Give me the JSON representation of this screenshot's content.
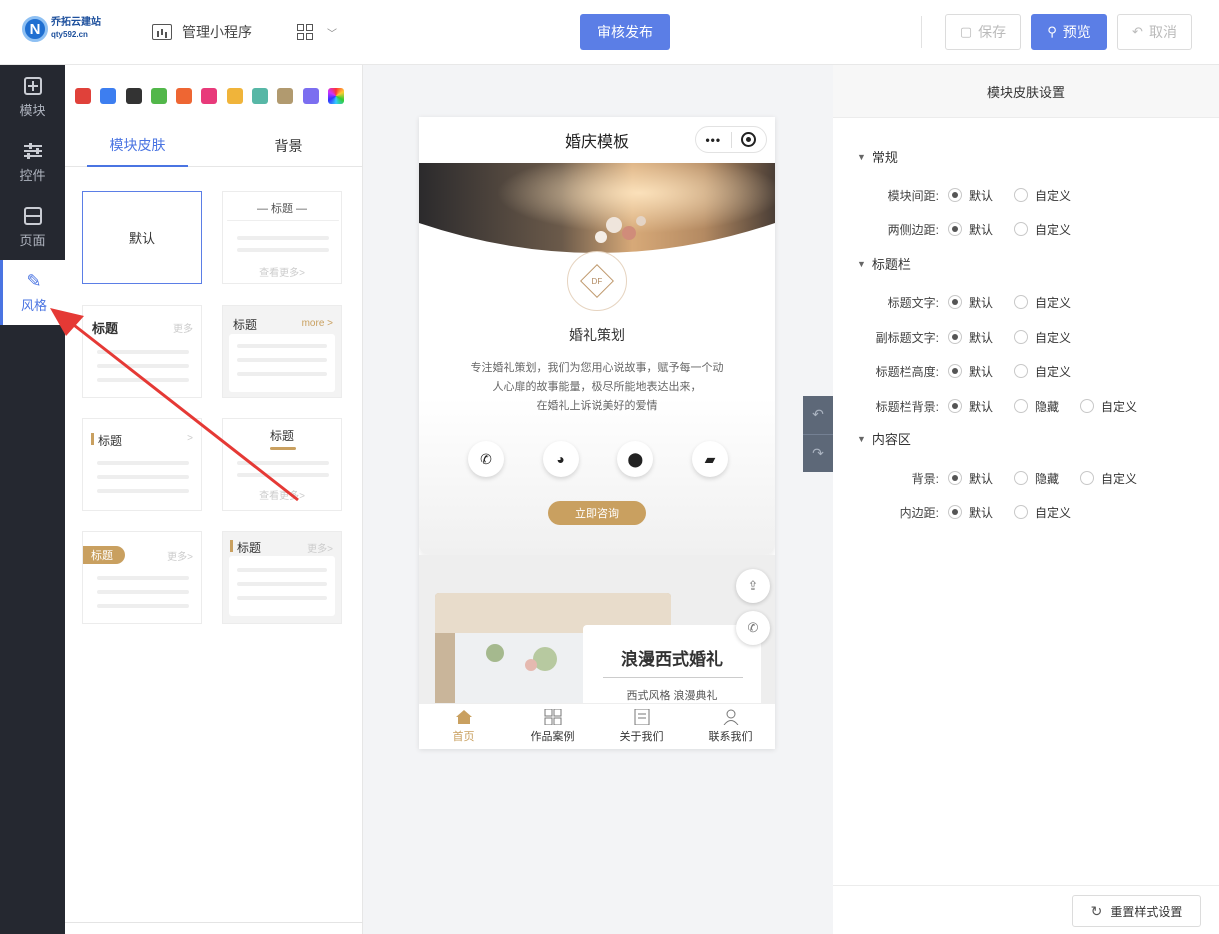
{
  "app": {
    "logo_name": "乔拓云建站",
    "logo_url": "qty592.cn",
    "manage_label": "管理小程序",
    "publish_label": "审核发布",
    "save_label": "保存",
    "preview_label": "预览",
    "cancel_label": "取消",
    "accent_color": "#5b7ee6"
  },
  "left_nav": {
    "items": [
      {
        "label": "模块",
        "icon": "plus-square-icon"
      },
      {
        "label": "控件",
        "icon": "sliders-icon"
      },
      {
        "label": "页面",
        "icon": "page-icon"
      },
      {
        "label": "风格",
        "icon": "magic-wand-icon",
        "active": true
      }
    ]
  },
  "style_panel": {
    "swatches": [
      "#e0413a",
      "#3d7ef0",
      "#333333",
      "#52b74a",
      "#ee6633",
      "#e83a7a",
      "#f0b43a",
      "#57b7a6",
      "#b19a6f",
      "#7b6ef0",
      "rainbow"
    ],
    "tabs": [
      "模块皮肤",
      "背景"
    ],
    "active_tab": 0,
    "cards": [
      {
        "kind": "default",
        "label": "默认",
        "selected": true
      },
      {
        "kind": "centered",
        "title": "标题",
        "more": "查看更多>"
      },
      {
        "kind": "bold-left",
        "title": "标题",
        "more": "更多"
      },
      {
        "kind": "card-more",
        "title": "标题",
        "more": "more >"
      },
      {
        "kind": "bar-left",
        "title": "标题",
        "more": ">"
      },
      {
        "kind": "underline",
        "title": "标题",
        "more": "查看更多>"
      },
      {
        "kind": "tag",
        "title": "标题",
        "more": "更多>"
      },
      {
        "kind": "grey-bar",
        "title": "标题",
        "more": "更多>"
      }
    ]
  },
  "phone": {
    "page_title": "婚庆模板",
    "emblem_text": "DF",
    "brand_title": "婚礼策划",
    "desc_lines": [
      "专注婚礼策划，我们为您用心说故事，赋予每一个动",
      "人心扉的故事能量，极尽所能地表达出来，",
      "在婚礼上诉说美好的爱情"
    ],
    "action_icons": [
      "phone-icon",
      "wechat-icon",
      "location-icon",
      "message-icon"
    ],
    "consult_label": "立即咨询",
    "feature_title": "浪漫西式婚礼",
    "feature_sub": "西式风格 浪漫典礼",
    "tabbar": [
      {
        "label": "首页",
        "active": true
      },
      {
        "label": "作品案例"
      },
      {
        "label": "关于我们"
      },
      {
        "label": "联系我们"
      }
    ],
    "gold_color": "#c9a060"
  },
  "right_panel": {
    "title": "模块皮肤设置",
    "sections": [
      {
        "name": "常规",
        "rows": [
          {
            "label": "模块间距:",
            "options": [
              "默认",
              "自定义"
            ],
            "selected": 0
          },
          {
            "label": "两侧边距:",
            "options": [
              "默认",
              "自定义"
            ],
            "selected": 0
          }
        ]
      },
      {
        "name": "标题栏",
        "rows": [
          {
            "label": "标题文字:",
            "options": [
              "默认",
              "自定义"
            ],
            "selected": 0
          },
          {
            "label": "副标题文字:",
            "options": [
              "默认",
              "自定义"
            ],
            "selected": 0
          },
          {
            "label": "标题栏高度:",
            "options": [
              "默认",
              "自定义"
            ],
            "selected": 0
          },
          {
            "label": "标题栏背景:",
            "options": [
              "默认",
              "隐藏",
              "自定义"
            ],
            "selected": 0
          }
        ]
      },
      {
        "name": "内容区",
        "rows": [
          {
            "label": "背景:",
            "options": [
              "默认",
              "隐藏",
              "自定义"
            ],
            "selected": 0
          },
          {
            "label": "内边距:",
            "options": [
              "默认",
              "自定义"
            ],
            "selected": 0
          }
        ]
      }
    ],
    "reset_label": "重置样式设置"
  }
}
